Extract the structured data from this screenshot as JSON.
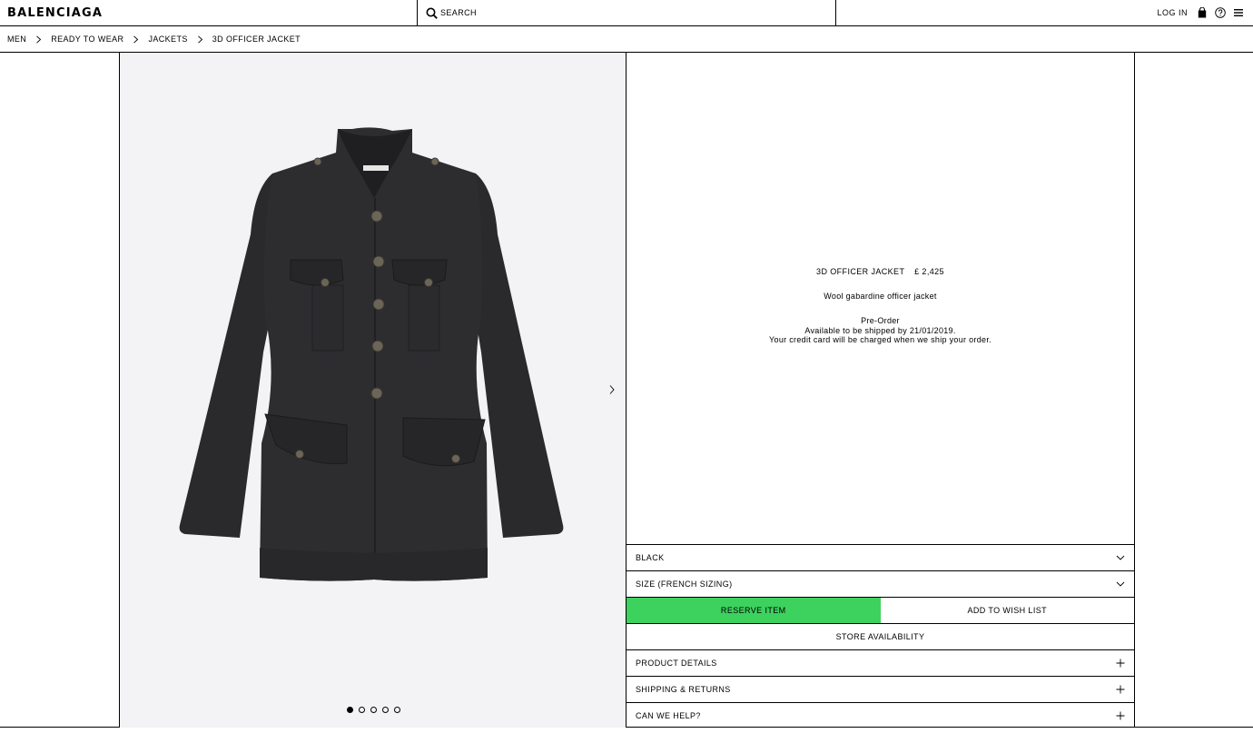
{
  "brand": {
    "logo": "BALENCIAGA"
  },
  "header": {
    "search_placeholder": "SEARCH",
    "login_label": "LOG IN",
    "icons": [
      "search-icon",
      "bag-icon",
      "help-icon",
      "menu-icon"
    ]
  },
  "breadcrumb": {
    "items": [
      "MEN",
      "READY TO WEAR",
      "JACKETS",
      "3D OFFICER JACKET"
    ]
  },
  "gallery": {
    "image_count": 5,
    "active_index": 0
  },
  "product": {
    "name": "3D OFFICER JACKET",
    "price": "£  2,425",
    "description": "Wool gabardine officer jacket",
    "preorder": {
      "label": "Pre-Order",
      "shipping": "Available to be shipped by 21/01/2019.",
      "note": "Your credit card will be charged when we ship your order."
    }
  },
  "options": {
    "color": "BLACK",
    "size": "SIZE (FRENCH SIZING)"
  },
  "actions": {
    "reserve_label": "RESERVE ITEM",
    "wishlist_label": "ADD TO WISH LIST",
    "store_label": "STORE AVAILABILITY"
  },
  "accordions": {
    "details": "PRODUCT DETAILS",
    "shipping": "SHIPPING & RETURNS",
    "help": "CAN WE HELP?"
  },
  "colors": {
    "reserve_button": "#3dd15e",
    "gallery_bg": "#f3f3f5"
  }
}
